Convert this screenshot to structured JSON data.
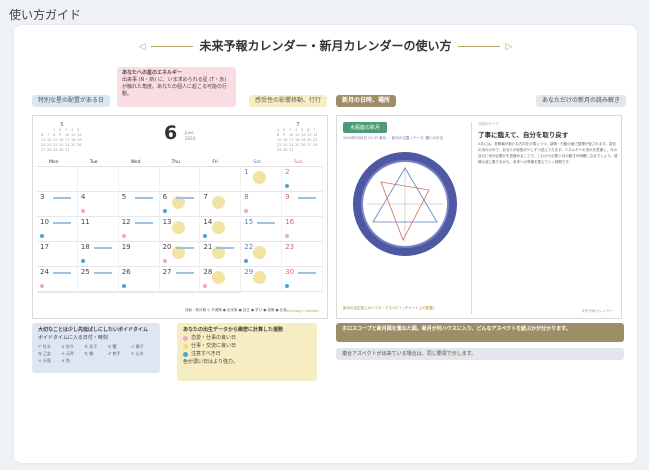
{
  "page": {
    "heading": "使い方ガイド"
  },
  "title": {
    "text": "未来予報カレンダー・新月カレンダーの使い方",
    "left_arrow": "◁",
    "right_arrow": "▷"
  },
  "tags": {
    "best_days": "特別な星の配置がある日",
    "energy_title": "あなたへの星のエネルギー",
    "energy_body": "出来事 (N・新) に、いま求められる星 (T・赤) が触れた角度。あなたの個人に起こる可能の行動。",
    "action": "感受性の影響移動、行行",
    "newmoon_tag": "新月の日時、場所",
    "newmoon_right": "あなただけの新月の読み解き"
  },
  "calendar": {
    "month_num": "6",
    "month_en": "June",
    "year": "2024",
    "mini_left_title": "5",
    "mini_right_title": "7",
    "weekdays": [
      "Mon",
      "Tue",
      "Wed",
      "Thu",
      "Fri",
      "Sat",
      "Sun"
    ],
    "days": [
      "",
      "",
      "",
      "",
      "",
      "1",
      "2",
      "3",
      "4",
      "5",
      "6",
      "7",
      "8",
      "9",
      "10",
      "11",
      "12",
      "13",
      "14",
      "15",
      "16",
      "17",
      "18",
      "19",
      "20",
      "21",
      "22",
      "23",
      "24",
      "25",
      "26",
      "27",
      "28",
      "29",
      "30",
      "",
      "",
      "",
      "",
      ""
    ],
    "legend": "月齢・新月期 ◎ 不満期 ● 出来事 ● 目立 ● 学び ● 感情 ● 仕事",
    "logo": "Astrology Calendar"
  },
  "chart_panel": {
    "tab": "水瓶座の新月",
    "sub": "2024年6月6日 21:37 東京 ・ 新月の位置 / テーマ: 願いの手法",
    "small": "今回のテーマ",
    "head": "了事に臨えて、自分を取り戻す",
    "body": "2月には、参照軸が新たな方向を示唆しつつ、感情・行動の面で整理が促されます。変化の流れの中で、あなたの役割が少しずつ見えてきます。エネルギーの流れを意識し、今の自分に何が必要かを見極めることで、これからの数ヶ月の動きが明確になるでしょう。感情の波に乗りながら、未来への準備を整えていく時期です。",
    "foot": "新月の出生図上のハウス・アスペクト (チャート上の配置)",
    "mark": "未来予報カレンダー"
  },
  "notes": {
    "blue_title": "大切なことは少し先延ばしにしたいボイドタイム",
    "blue_sub": "ボイドタイムに入る日付・時刻",
    "blue_grid": [
      "♈ 牡羊",
      "♉ 牡牛",
      "♊ 双子",
      "♋ 蟹",
      "♌ 獅子",
      "♍ 乙女",
      "♎ 天秤",
      "♏ 蠍",
      "♐ 射手",
      "♑ 山羊",
      "♒ 水瓶",
      "♓ 魚"
    ],
    "yellow_title": "あなたの出生データから緻密に計算した運勢",
    "yellow_items": [
      "恋愛・仕事の良い日",
      "仕事・交流に良い日",
      "注意すべき日"
    ],
    "yellow_foot": "色が濃い日はより強力。",
    "brown": "ホロスコープと新月図を重ねた図。新月が何ハウスに入り、どんなアスペクトを結ぶかが分かります。",
    "gray": "複合アスペクトが出来ている場合は、同じ要領で示します。"
  },
  "colors": {
    "accent": "#9e8e67",
    "teal": "#4c9a77",
    "wheel": "#4f58a2"
  }
}
